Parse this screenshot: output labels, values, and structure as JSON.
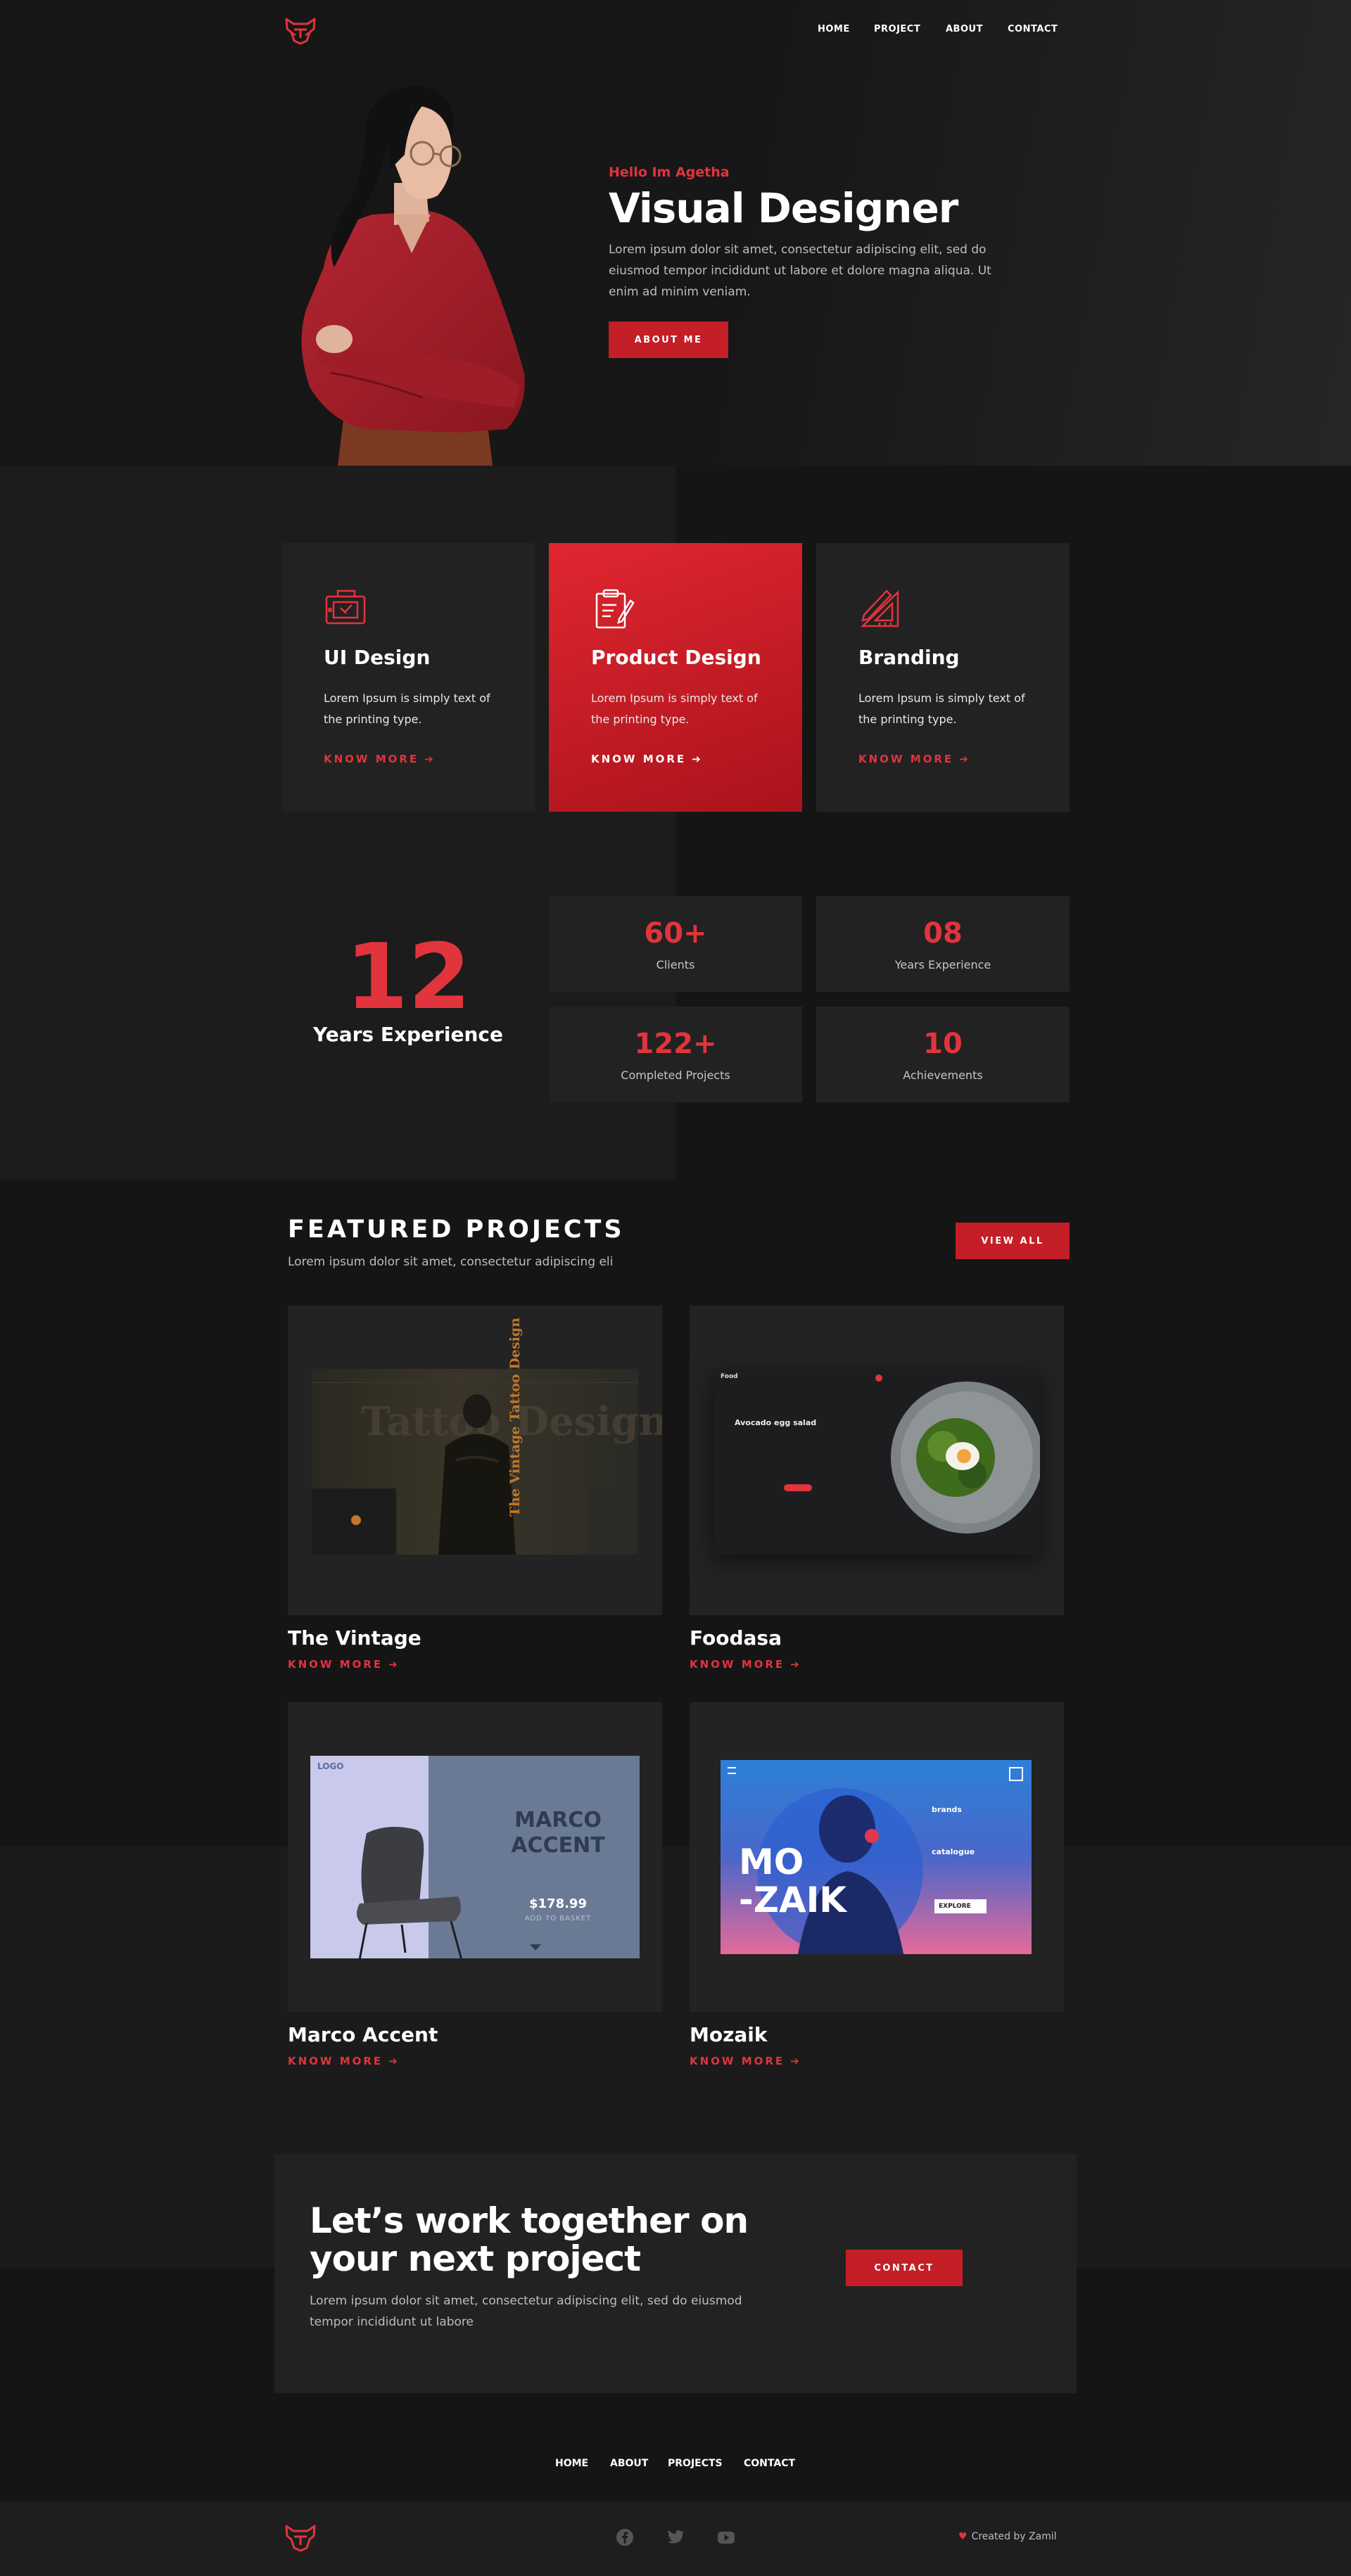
{
  "nav": {
    "items": [
      "HOME",
      "PROJECT",
      "ABOUT",
      "CONTACT"
    ]
  },
  "hero": {
    "greeting": "Hello Im Agetha",
    "title": "Visual Designer",
    "text": "Lorem ipsum dolor sit amet, consectetur adipiscing elit, sed do eiusmod tempor incididunt ut labore et dolore magna aliqua. Ut enim ad minim veniam.",
    "button": "ABOUT ME"
  },
  "services": [
    {
      "title": "UI Design",
      "text": "Lorem Ipsum is simply text of the printing type.",
      "link": "KNOW MORE",
      "icon": "tablet-icon"
    },
    {
      "title": "Product Design",
      "text": "Lorem Ipsum is simply text of the printing type.",
      "link": "KNOW MORE",
      "icon": "clipboard-icon"
    },
    {
      "title": "Branding",
      "text": "Lorem Ipsum is simply text of the printing type.",
      "link": "KNOW MORE",
      "icon": "ruler-pencil-icon"
    }
  ],
  "experience": {
    "number": "12",
    "label": "Years Experience"
  },
  "stats": [
    {
      "value": "60+",
      "label": "Clients"
    },
    {
      "value": "08",
      "label": "Years Experience"
    },
    {
      "value": "122+",
      "label": "Completed Projects"
    },
    {
      "value": "10",
      "label": "Achievements"
    }
  ],
  "featured": {
    "title": "FEATURED PROJECTS",
    "subtitle": "Lorem ipsum dolor sit amet, consectetur adipiscing eli",
    "button": "VIEW ALL"
  },
  "projects": [
    {
      "name": "The Vintage",
      "link": "KNOW MORE",
      "thumb": {
        "title": "The Vintage Tattoo Design",
        "bg": "Tattoo Design"
      }
    },
    {
      "name": "Foodasa",
      "link": "KNOW MORE",
      "thumb": {
        "title": "Avocado egg salad",
        "brand": "Food"
      }
    },
    {
      "name": "Marco Accent",
      "link": "KNOW MORE",
      "thumb": {
        "logo": "LOGO",
        "title1": "MARCO",
        "title2": "ACCENT",
        "price": "$178.99",
        "cta": "ADD TO BASKET"
      }
    },
    {
      "name": "Mozaik",
      "link": "KNOW MORE",
      "thumb": {
        "line1": "MO",
        "line2": "-ZAIK",
        "brands": "brands",
        "catalogue": "catalogue",
        "button": "EXPLORE"
      }
    }
  ],
  "cta": {
    "title": "Let’s work together on your next project",
    "text": "Lorem ipsum dolor sit amet, consectetur adipiscing elit, sed do eiusmod tempor incididunt ut labore",
    "button": "CONTACT"
  },
  "footer": {
    "nav": [
      "HOME",
      "ABOUT",
      "PROJECTS",
      "CONTACT"
    ],
    "credit": "Created by Zamil",
    "social": [
      "facebook-icon",
      "twitter-icon",
      "youtube-icon"
    ]
  },
  "colors": {
    "accent": "#e1343c",
    "button": "#c41e27",
    "background": "#151515",
    "card": "#222222"
  }
}
